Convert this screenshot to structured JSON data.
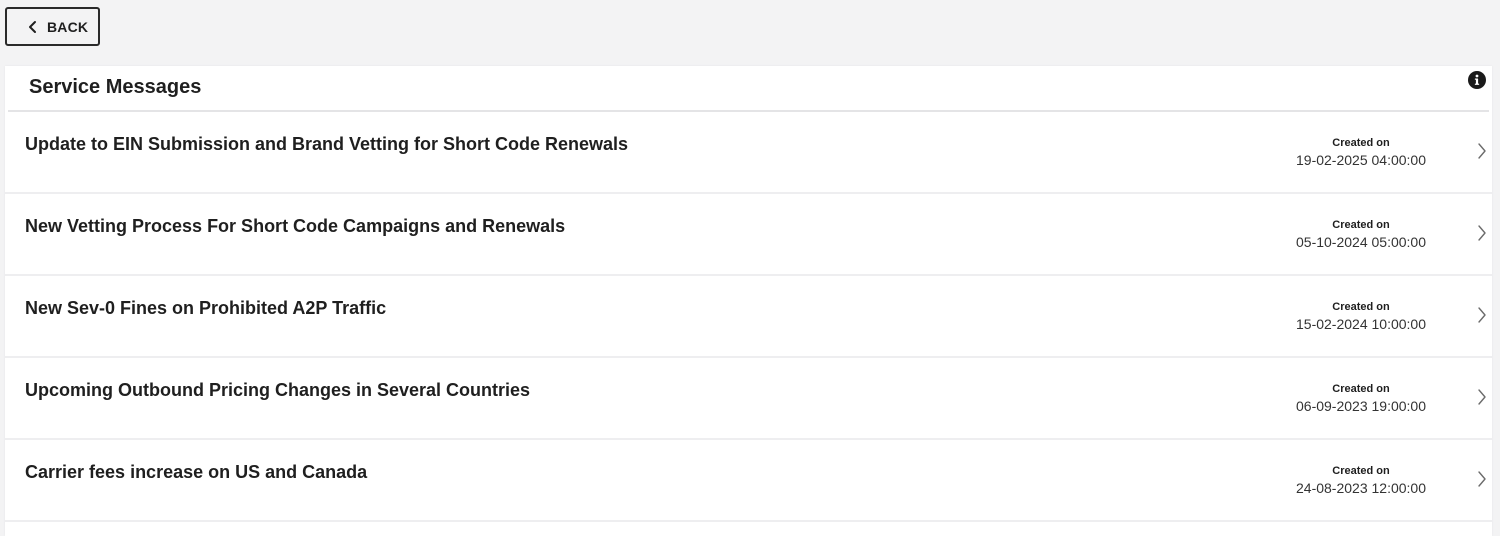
{
  "back_button": {
    "label": "BACK",
    "icon": "chevron-left-icon"
  },
  "panel": {
    "title": "Service Messages",
    "info_icon": "info-icon"
  },
  "messages": [
    {
      "title": "Update to EIN Submission and Brand Vetting for Short Code Renewals",
      "created_label": "Created on",
      "created_date": "19-02-2025 04:00:00"
    },
    {
      "title": "New Vetting Process For Short Code Campaigns and Renewals",
      "created_label": "Created on",
      "created_date": "05-10-2024 05:00:00"
    },
    {
      "title": "New Sev-0 Fines on Prohibited A2P Traffic",
      "created_label": "Created on",
      "created_date": "15-02-2024 10:00:00"
    },
    {
      "title": "Upcoming Outbound Pricing Changes in Several Countries",
      "created_label": "Created on",
      "created_date": "06-09-2023 19:00:00"
    },
    {
      "title": "Carrier fees increase on US and Canada",
      "created_label": "Created on",
      "created_date": "24-08-2023 12:00:00"
    }
  ],
  "colors": {
    "page_background": "#f3f3f4",
    "panel_background": "#ffffff",
    "text": "#1f1f1f",
    "divider": "#eeeef0"
  }
}
